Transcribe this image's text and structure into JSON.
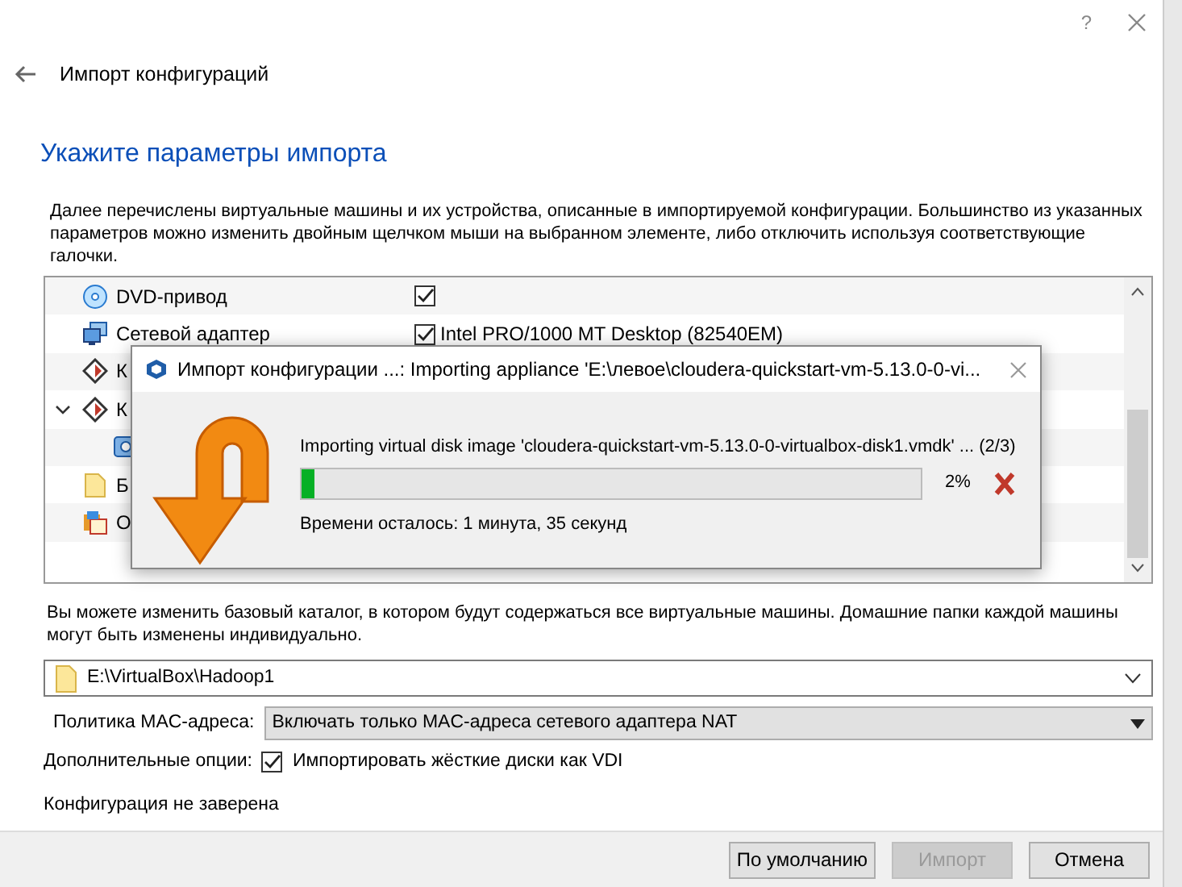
{
  "window": {
    "help": "?",
    "title": "Импорт конфигураций"
  },
  "heading": "Укажите параметры импорта",
  "description": "Далее перечислены виртуальные машины и их устройства, описанные в импортируемой конфигурации. Большинство из указанных параметров можно изменить двойным щелчком мыши на выбранном элементе, либо отключить используя соответствующие галочки.",
  "tree": {
    "rows": [
      {
        "kind": "dvd",
        "label": "DVD-привод",
        "checked": true
      },
      {
        "kind": "network",
        "label": "Сетевой адаптер",
        "checked": true,
        "value": "Intel PRO/1000 MT Desktop (82540EM)"
      },
      {
        "kind": "controller",
        "label": "К"
      },
      {
        "kind": "controller",
        "label": "К",
        "expanded": true,
        "children": [
          {
            "kind": "disk"
          }
        ]
      },
      {
        "kind": "folder",
        "label": "Б"
      },
      {
        "kind": "os",
        "label": "О"
      }
    ]
  },
  "progress_dialog": {
    "title": "Импорт конфигурации ...: Importing appliance 'E:\\левое\\cloudera-quickstart-vm-5.13.0-0-vi...",
    "message": "Importing virtual disk image 'cloudera-quickstart-vm-5.13.0-0-virtualbox-disk1.vmdk' ... (2/3)",
    "level": 0.02,
    "percent": "2%",
    "remaining": "Времени осталось: 1 минута, 35 секунд"
  },
  "base_folder": {
    "info": "Вы можете изменить базовый каталог, в котором будут содержаться все виртуальные машины. Домашние папки каждой машины могут быть изменены индивидуально.",
    "path": "E:\\VirtualBox\\Hadoop1"
  },
  "mac_policy": {
    "label": "Политика MAC-адреса:",
    "value": "Включать только MAC-адреса сетевого адаптера NAT"
  },
  "options": {
    "label": "Дополнительные опции:",
    "checkbox": "Импортировать жёсткие диски как VDI",
    "checked": true
  },
  "status": "Конфигурация не заверена",
  "buttons": [
    {
      "label": "По умолчанию",
      "disabled": false
    },
    {
      "label": "Импорт",
      "disabled": true
    },
    {
      "label": "Отмена",
      "disabled": false
    }
  ]
}
